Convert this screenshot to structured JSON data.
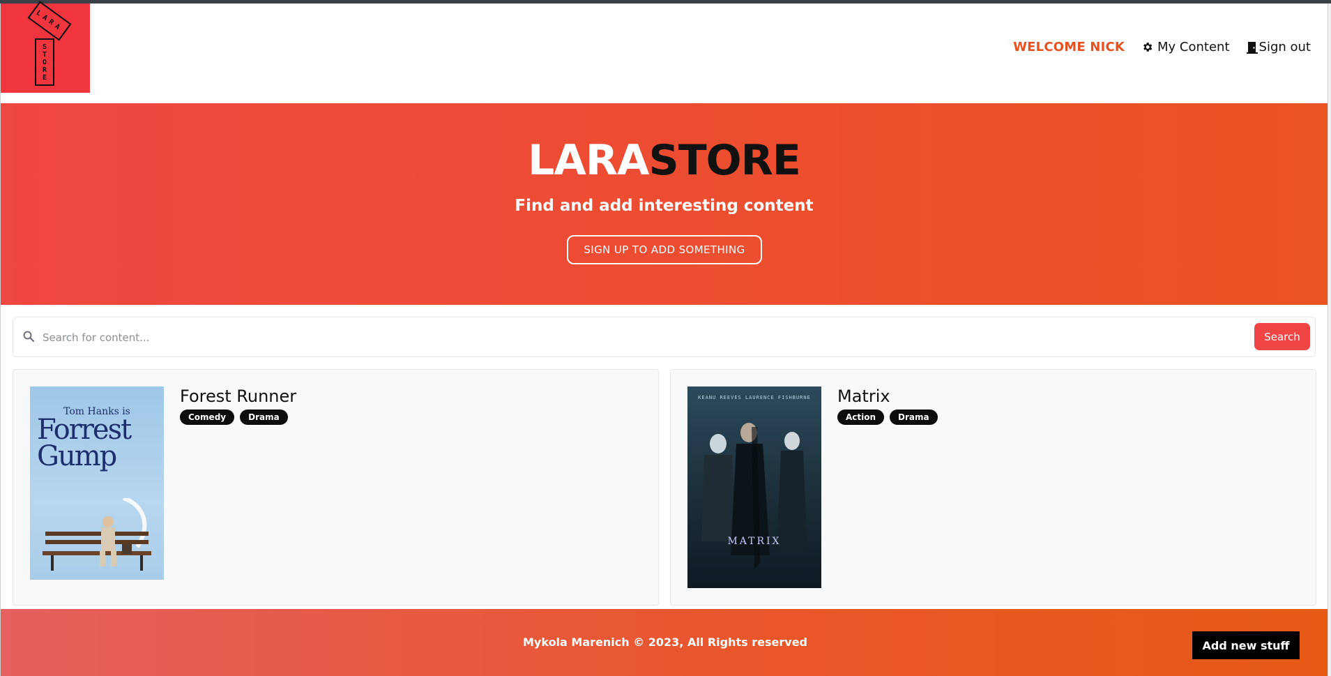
{
  "brand": {
    "logo_top": "LARA",
    "logo_bottom": [
      "S",
      "T",
      "O",
      "R",
      "E"
    ],
    "accent": "#f0353f"
  },
  "nav": {
    "welcome": "WELCOME NICK",
    "my_content": "My Content",
    "sign_out": "Sign out"
  },
  "hero": {
    "title_part1": "LARA",
    "title_part2": "STORE",
    "subtitle": "Find and add interesting content",
    "cta": "SIGN UP TO ADD SOMETHING"
  },
  "search": {
    "placeholder": "Search for content...",
    "value": "",
    "button": "Search"
  },
  "items": [
    {
      "title": "Forest Runner",
      "tags": [
        "Comedy",
        "Drama"
      ],
      "poster": {
        "actor": "Tom Hanks is",
        "line1": "Forrest",
        "line2": "Gump"
      }
    },
    {
      "title": "Matrix",
      "tags": [
        "Action",
        "Drama"
      ],
      "poster": {
        "credits": "KEANU REEVES   LAURENCE FISHBURNE",
        "name": "MATRIX"
      }
    }
  ],
  "footer": {
    "copyright": "Mykola Marenich © 2023, All Rights reserved",
    "add_button": "Add new stuff"
  }
}
